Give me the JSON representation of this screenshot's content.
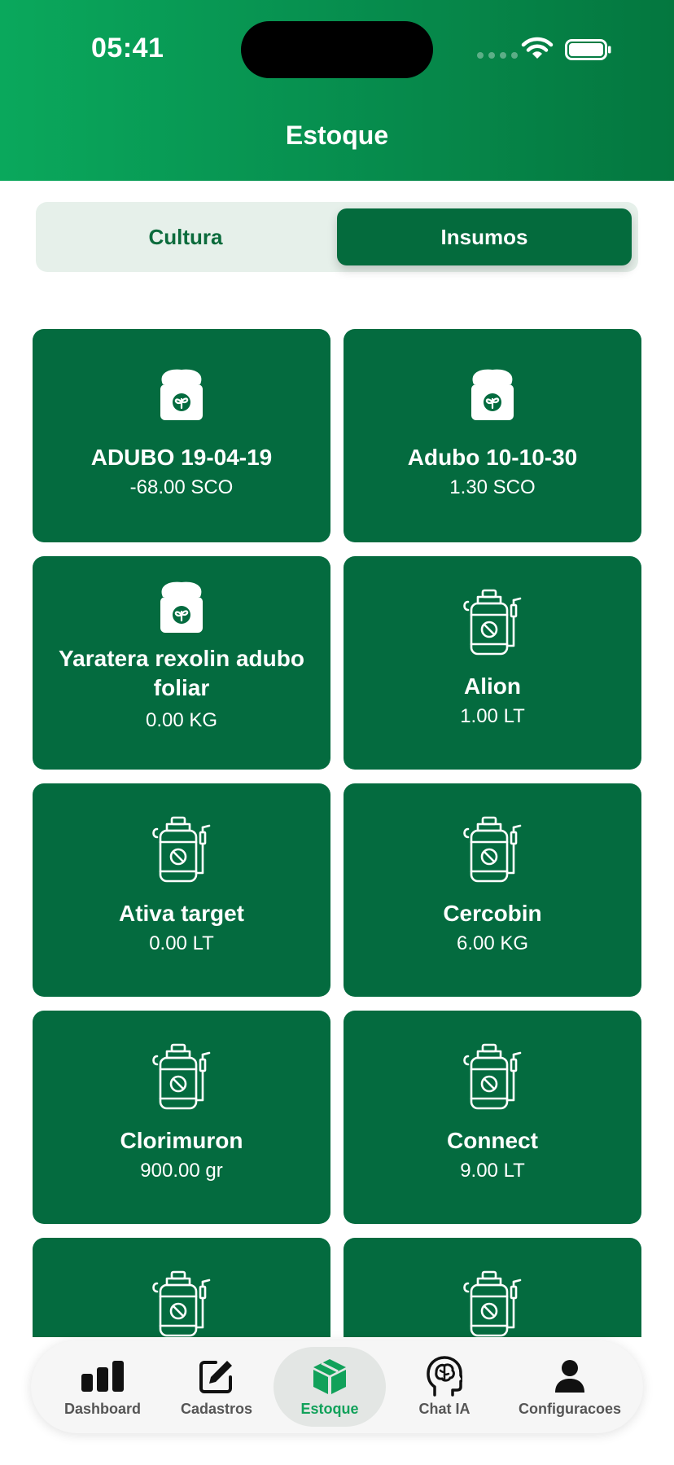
{
  "status_bar": {
    "time": "05:41"
  },
  "header": {
    "title": "Estoque"
  },
  "segmented": {
    "left_label": "Cultura",
    "right_label": "Insumos",
    "selected": "Insumos"
  },
  "items": [
    {
      "name": "ADUBO 19-04-19",
      "qty": "-68.00 SCO",
      "icon": "fertilizer-sack-icon"
    },
    {
      "name": "Adubo 10-10-30",
      "qty": "1.30 SCO",
      "icon": "fertilizer-sack-icon"
    },
    {
      "name": "Yaratera rexolin adubo foliar",
      "qty": "0.00 KG",
      "icon": "fertilizer-sack-icon"
    },
    {
      "name": "Alion",
      "qty": "1.00 LT",
      "icon": "sprayer-icon"
    },
    {
      "name": "Ativa target",
      "qty": "0.00 LT",
      "icon": "sprayer-icon"
    },
    {
      "name": "Cercobin",
      "qty": "6.00 KG",
      "icon": "sprayer-icon"
    },
    {
      "name": "Clorimuron",
      "qty": "900.00 gr",
      "icon": "sprayer-icon"
    },
    {
      "name": "Connect",
      "qty": "9.00 LT",
      "icon": "sprayer-icon"
    },
    {
      "name": "",
      "qty": "",
      "icon": "sprayer-icon"
    },
    {
      "name": "",
      "qty": "",
      "icon": "sprayer-icon"
    }
  ],
  "tabbar": {
    "active": "Estoque",
    "tabs": [
      {
        "label": "Dashboard",
        "icon": "bar-chart-icon"
      },
      {
        "label": "Cadastros",
        "icon": "edit-icon"
      },
      {
        "label": "Estoque",
        "icon": "box-icon"
      },
      {
        "label": "Chat IA",
        "icon": "brain-head-icon"
      },
      {
        "label": "Configuracoes",
        "icon": "user-icon"
      }
    ]
  },
  "colors": {
    "primary": "#046b3f",
    "header_gradient_start": "#0aa85c",
    "header_gradient_end": "#04773f",
    "active_tab": "#11a15a"
  }
}
